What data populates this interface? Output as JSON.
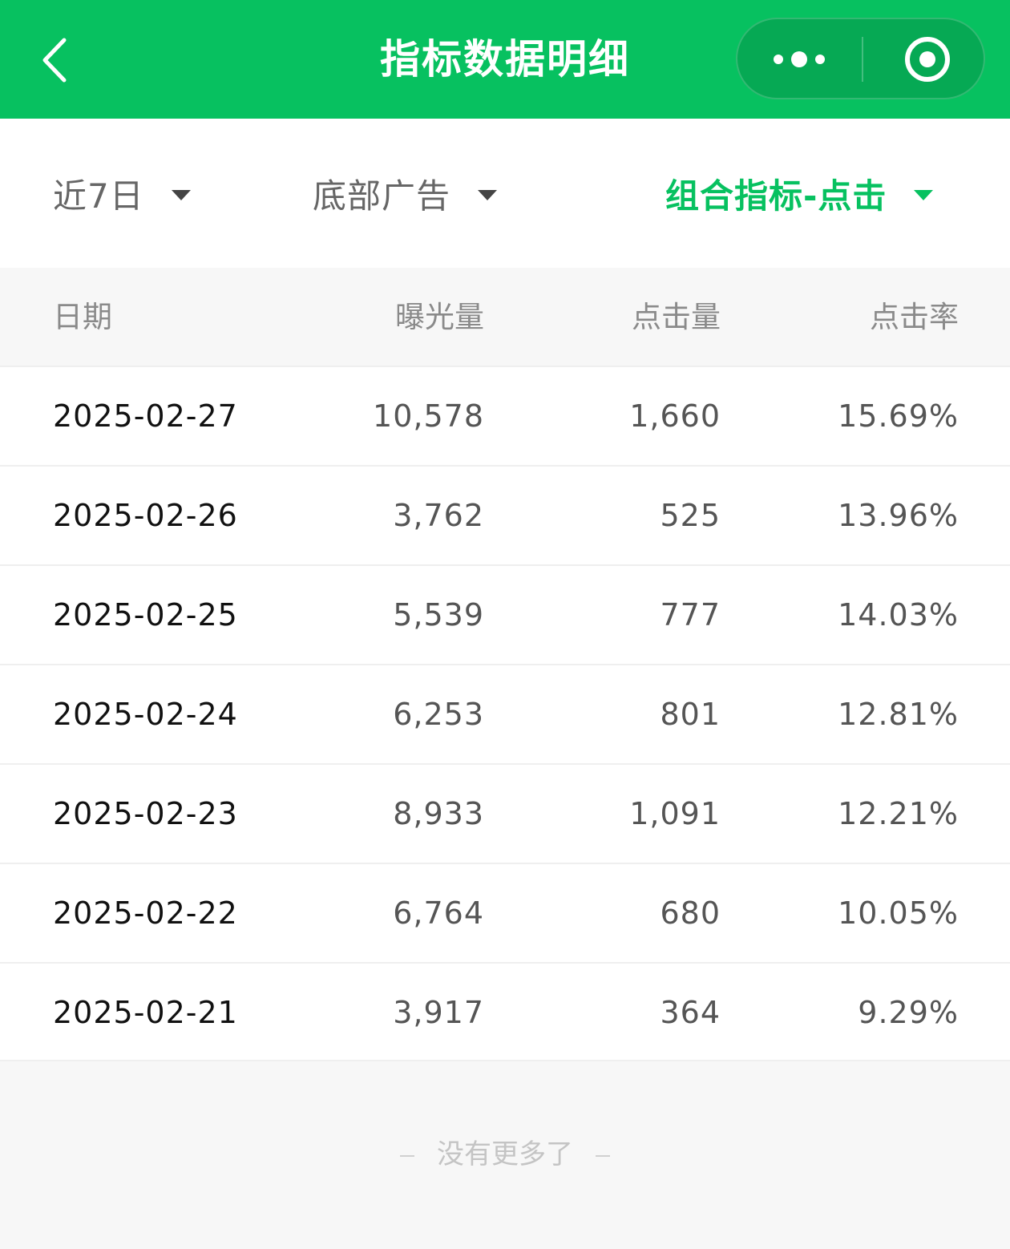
{
  "header": {
    "title": "指标数据明细",
    "background_color": "#07c160",
    "back_icon": "chevron-left-icon",
    "more_icon": "more-dots-icon",
    "close_icon": "target-circle-icon"
  },
  "filters": {
    "period": "近7日",
    "placement": "底部广告",
    "metric": "组合指标-点击",
    "active_color": "#07c160"
  },
  "table": {
    "columns": [
      "日期",
      "曝光量",
      "点击量",
      "点击率"
    ],
    "rows": [
      {
        "date": "2025-02-27",
        "impressions": "10,578",
        "clicks": "1,660",
        "ctr": "15.69%"
      },
      {
        "date": "2025-02-26",
        "impressions": "3,762",
        "clicks": "525",
        "ctr": "13.96%"
      },
      {
        "date": "2025-02-25",
        "impressions": "5,539",
        "clicks": "777",
        "ctr": "14.03%"
      },
      {
        "date": "2025-02-24",
        "impressions": "6,253",
        "clicks": "801",
        "ctr": "12.81%"
      },
      {
        "date": "2025-02-23",
        "impressions": "8,933",
        "clicks": "1,091",
        "ctr": "12.21%"
      },
      {
        "date": "2025-02-22",
        "impressions": "6,764",
        "clicks": "680",
        "ctr": "10.05%"
      },
      {
        "date": "2025-02-21",
        "impressions": "3,917",
        "clicks": "364",
        "ctr": "9.29%"
      }
    ]
  },
  "footer": {
    "text": "没有更多了"
  }
}
